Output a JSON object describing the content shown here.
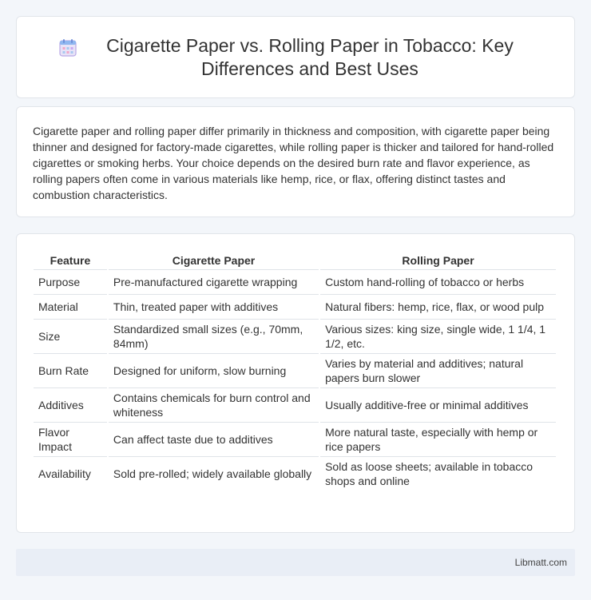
{
  "header": {
    "title": "Cigarette Paper vs. Rolling Paper in Tobacco: Key Differences and Best Uses",
    "icon": "calendar-icon"
  },
  "intro": {
    "text": "Cigarette paper and rolling paper differ primarily in thickness and composition, with cigarette paper being thinner and designed for factory-made cigarettes, while rolling paper is thicker and tailored for hand-rolled cigarettes or smoking herbs. Your choice depends on the desired burn rate and flavor experience, as rolling papers often come in various materials like hemp, rice, or flax, offering distinct tastes and combustion characteristics."
  },
  "table": {
    "headers": [
      "Feature",
      "Cigarette Paper",
      "Rolling Paper"
    ],
    "rows": [
      [
        "Purpose",
        "Pre-manufactured cigarette wrapping",
        "Custom hand-rolling of tobacco or herbs"
      ],
      [
        "Material",
        "Thin, treated paper with additives",
        "Natural fibers: hemp, rice, flax, or wood pulp"
      ],
      [
        "Size",
        "Standardized small sizes (e.g., 70mm, 84mm)",
        "Various sizes: king size, single wide, 1 1/4, 1 1/2, etc."
      ],
      [
        "Burn Rate",
        "Designed for uniform, slow burning",
        "Varies by material and additives; natural papers burn slower"
      ],
      [
        "Additives",
        "Contains chemicals for burn control and whiteness",
        "Usually additive-free or minimal additives"
      ],
      [
        "Flavor Impact",
        "Can affect taste due to additives",
        "More natural taste, especially with hemp or rice papers"
      ],
      [
        "Availability",
        "Sold pre-rolled; widely available globally",
        "Sold as loose sheets; available in tobacco shops and online"
      ]
    ]
  },
  "footer": {
    "brand": "Libmatt.com"
  }
}
